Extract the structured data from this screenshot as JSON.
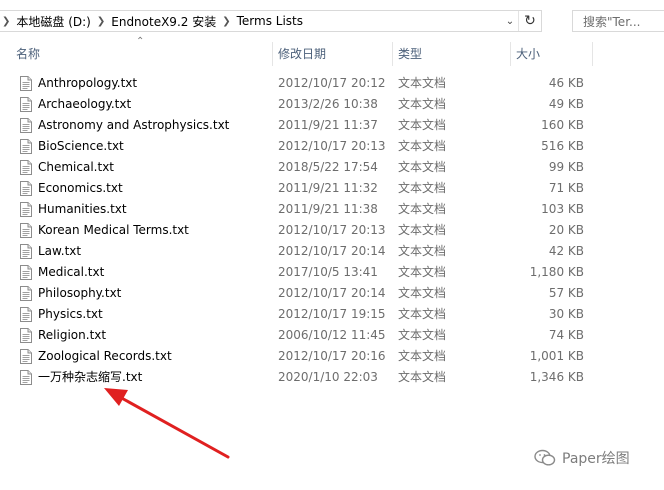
{
  "address_bar": {
    "breadcrumbs": [
      "本地磁盘 (D:)",
      "EndnoteX9.2 安装",
      "Terms Lists"
    ]
  },
  "search": {
    "placeholder": "搜索\"Ter..."
  },
  "columns": {
    "name": "名称",
    "date": "修改日期",
    "type": "类型",
    "size": "大小"
  },
  "files": [
    {
      "name": "Anthropology.txt",
      "date": "2012/10/17 20:12",
      "type": "文本文档",
      "size": "46 KB"
    },
    {
      "name": "Archaeology.txt",
      "date": "2013/2/26 10:38",
      "type": "文本文档",
      "size": "49 KB"
    },
    {
      "name": "Astronomy and Astrophysics.txt",
      "date": "2011/9/21 11:37",
      "type": "文本文档",
      "size": "160 KB"
    },
    {
      "name": "BioScience.txt",
      "date": "2012/10/17 20:13",
      "type": "文本文档",
      "size": "516 KB"
    },
    {
      "name": "Chemical.txt",
      "date": "2018/5/22 17:54",
      "type": "文本文档",
      "size": "99 KB"
    },
    {
      "name": "Economics.txt",
      "date": "2011/9/21 11:32",
      "type": "文本文档",
      "size": "71 KB"
    },
    {
      "name": "Humanities.txt",
      "date": "2011/9/21 11:38",
      "type": "文本文档",
      "size": "103 KB"
    },
    {
      "name": "Korean Medical Terms.txt",
      "date": "2012/10/17 20:13",
      "type": "文本文档",
      "size": "20 KB"
    },
    {
      "name": "Law.txt",
      "date": "2012/10/17 20:14",
      "type": "文本文档",
      "size": "42 KB"
    },
    {
      "name": "Medical.txt",
      "date": "2017/10/5 13:41",
      "type": "文本文档",
      "size": "1,180 KB"
    },
    {
      "name": "Philosophy.txt",
      "date": "2012/10/17 20:14",
      "type": "文本文档",
      "size": "57 KB"
    },
    {
      "name": "Physics.txt",
      "date": "2012/10/17 19:15",
      "type": "文本文档",
      "size": "30 KB"
    },
    {
      "name": "Religion.txt",
      "date": "2006/10/12 11:45",
      "type": "文本文档",
      "size": "74 KB"
    },
    {
      "name": "Zoological Records.txt",
      "date": "2012/10/17 20:16",
      "type": "文本文档",
      "size": "1,001 KB"
    },
    {
      "name": "一万种杂志缩写.txt",
      "date": "2020/1/10 22:03",
      "type": "文本文档",
      "size": "1,346 KB"
    }
  ],
  "watermark": {
    "text": "Paper绘图"
  },
  "icons": {
    "file": "text-file-icon",
    "refresh": "refresh-icon",
    "dropdown": "chevron-down-icon",
    "sort": "sort-up-icon"
  },
  "colors": {
    "annotation_arrow": "#e02020",
    "header_text": "#4c607a",
    "secondary_text": "#6d6d6d"
  }
}
